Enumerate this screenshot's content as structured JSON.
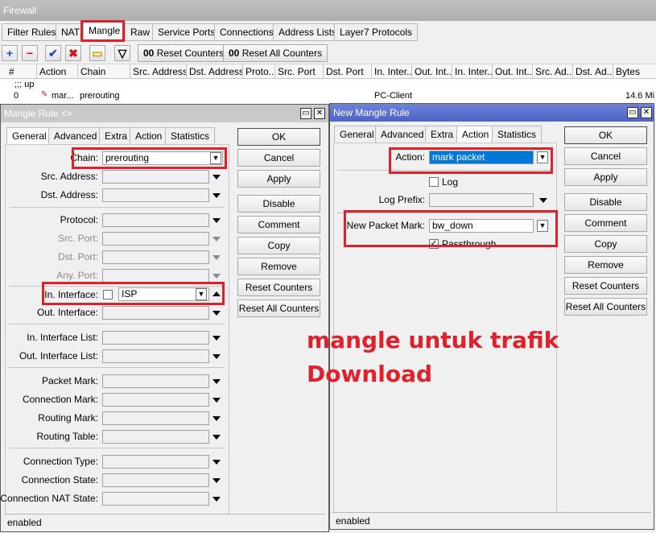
{
  "window": {
    "title": "Firewall"
  },
  "main_tabs": [
    {
      "label": "Filter Rules"
    },
    {
      "label": "NAT"
    },
    {
      "label": "Mangle"
    },
    {
      "label": "Raw"
    },
    {
      "label": "Service Ports"
    },
    {
      "label": "Connections"
    },
    {
      "label": "Address Lists"
    },
    {
      "label": "Layer7 Protocols"
    }
  ],
  "toolbar": {
    "add": "+",
    "remove": "−",
    "enable": "✔",
    "disable": "✖",
    "comment": "▭",
    "filter": "▽",
    "reset_counters": "Reset Counters",
    "reset_all_counters": "Reset All Counters",
    "counter_prefix": "00"
  },
  "grid": {
    "columns": [
      "#",
      "Action",
      "Chain",
      "Src. Address",
      "Dst. Address",
      "Proto...",
      "Src. Port",
      "Dst. Port",
      "In. Inter...",
      "Out. Int...",
      "In. Inter...",
      "Out. Int...",
      "Src. Ad...",
      "Dst. Ad...",
      "Bytes"
    ],
    "group": ";;; up",
    "row": {
      "num": "0",
      "action": "mar...",
      "chain": "prerouting",
      "in_interface": "PC-Client",
      "bytes": "14.6 Mi"
    }
  },
  "left_dialog": {
    "title": "Mangle Rule <>",
    "tabs": [
      "General",
      "Advanced",
      "Extra",
      "Action",
      "Statistics"
    ],
    "fields": {
      "chain": {
        "label": "Chain:",
        "value": "prerouting"
      },
      "src_address": {
        "label": "Src. Address:"
      },
      "dst_address": {
        "label": "Dst. Address:"
      },
      "protocol": {
        "label": "Protocol:"
      },
      "src_port": {
        "label": "Src. Port:"
      },
      "dst_port": {
        "label": "Dst. Port:"
      },
      "any_port": {
        "label": "Any. Port:"
      },
      "in_interface": {
        "label": "In. Interface:",
        "value": "ISP"
      },
      "out_interface": {
        "label": "Out. Interface:"
      },
      "in_interface_list": {
        "label": "In. Interface List:"
      },
      "out_interface_list": {
        "label": "Out. Interface List:"
      },
      "packet_mark": {
        "label": "Packet Mark:"
      },
      "connection_mark": {
        "label": "Connection Mark:"
      },
      "routing_mark": {
        "label": "Routing Mark:"
      },
      "routing_table": {
        "label": "Routing Table:"
      },
      "connection_type": {
        "label": "Connection Type:"
      },
      "connection_state": {
        "label": "Connection State:"
      },
      "connection_nat_state": {
        "label": "Connection NAT State:"
      }
    },
    "buttons": [
      "OK",
      "Cancel",
      "Apply",
      "Disable",
      "Comment",
      "Copy",
      "Remove",
      "Reset Counters",
      "Reset All Counters"
    ],
    "status": "enabled"
  },
  "right_dialog": {
    "title": "New Mangle Rule",
    "tabs": [
      "General",
      "Advanced",
      "Extra",
      "Action",
      "Statistics"
    ],
    "fields": {
      "action": {
        "label": "Action:",
        "value": "mark packet"
      },
      "log": {
        "label": "Log"
      },
      "log_prefix": {
        "label": "Log Prefix:"
      },
      "new_packet_mark": {
        "label": "New Packet Mark:",
        "value": "bw_down"
      },
      "passthrough": {
        "label": "Passthrough"
      }
    },
    "buttons": [
      "OK",
      "Cancel",
      "Apply",
      "Disable",
      "Comment",
      "Copy",
      "Remove",
      "Reset Counters",
      "Reset All Counters"
    ],
    "status": "enabled"
  },
  "annotation": {
    "line1": "mangle untuk trafik",
    "line2": "Download"
  },
  "colors": {
    "highlight": "#e0202a",
    "selection": "#0078d7",
    "active_title": "#4c63c8"
  }
}
